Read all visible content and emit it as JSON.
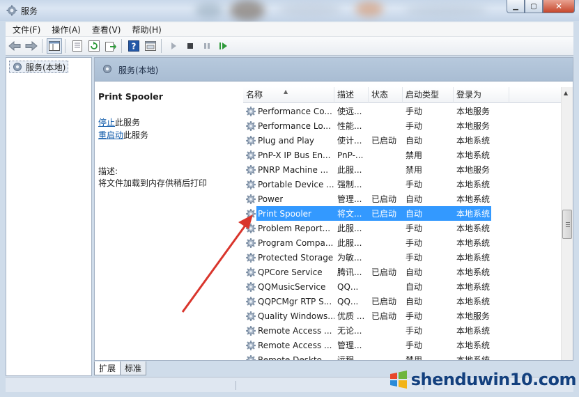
{
  "window": {
    "title": "服务"
  },
  "menu": [
    "文件(F)",
    "操作(A)",
    "查看(V)",
    "帮助(H)"
  ],
  "tree": {
    "root": "服务(本地)"
  },
  "pane_header": "服务(本地)",
  "details": {
    "service_name": "Print Spooler",
    "stop_link": "停止",
    "stop_suffix": "此服务",
    "restart_link": "重启动",
    "restart_suffix": "此服务",
    "desc_label": "描述:",
    "desc_text": "将文件加载到内存供稍后打印"
  },
  "columns": [
    "名称",
    "描述",
    "状态",
    "启动类型",
    "登录为"
  ],
  "services": [
    {
      "name": "Performance Co...",
      "desc": "使远...",
      "status": "",
      "startup": "手动",
      "logon": "本地服务"
    },
    {
      "name": "Performance Lo...",
      "desc": "性能...",
      "status": "",
      "startup": "手动",
      "logon": "本地服务"
    },
    {
      "name": "Plug and Play",
      "desc": "使计...",
      "status": "已启动",
      "startup": "自动",
      "logon": "本地系统"
    },
    {
      "name": "PnP-X IP Bus En...",
      "desc": "PnP-...",
      "status": "",
      "startup": "禁用",
      "logon": "本地系统"
    },
    {
      "name": "PNRP Machine ...",
      "desc": "此服...",
      "status": "",
      "startup": "禁用",
      "logon": "本地服务"
    },
    {
      "name": "Portable Device ...",
      "desc": "强制...",
      "status": "",
      "startup": "手动",
      "logon": "本地系统"
    },
    {
      "name": "Power",
      "desc": "管理...",
      "status": "已启动",
      "startup": "自动",
      "logon": "本地系统"
    },
    {
      "name": "Print Spooler",
      "desc": "将文...",
      "status": "已启动",
      "startup": "自动",
      "logon": "本地系统",
      "selected": true
    },
    {
      "name": "Problem Report...",
      "desc": "此服...",
      "status": "",
      "startup": "手动",
      "logon": "本地系统"
    },
    {
      "name": "Program Compa...",
      "desc": "此服...",
      "status": "",
      "startup": "手动",
      "logon": "本地系统"
    },
    {
      "name": "Protected Storage",
      "desc": "为敏...",
      "status": "",
      "startup": "手动",
      "logon": "本地系统"
    },
    {
      "name": "QPCore Service",
      "desc": "腾讯...",
      "status": "已启动",
      "startup": "自动",
      "logon": "本地系统"
    },
    {
      "name": "QQMusicService",
      "desc": "QQ...",
      "status": "",
      "startup": "自动",
      "logon": "本地系统"
    },
    {
      "name": "QQPCMgr RTP S...",
      "desc": "QQ...",
      "status": "已启动",
      "startup": "自动",
      "logon": "本地系统"
    },
    {
      "name": "Quality Windows...",
      "desc": "优质 ...",
      "status": "已启动",
      "startup": "手动",
      "logon": "本地服务"
    },
    {
      "name": "Remote Access ...",
      "desc": "无论...",
      "status": "",
      "startup": "手动",
      "logon": "本地系统"
    },
    {
      "name": "Remote Access ...",
      "desc": "管理...",
      "status": "",
      "startup": "手动",
      "logon": "本地系统"
    },
    {
      "name": "Remote Deskto...",
      "desc": "远程...",
      "status": "",
      "startup": "禁用",
      "logon": "本地系统"
    }
  ],
  "tabs": [
    "扩展",
    "标准"
  ],
  "watermark": "shenduwin10.com",
  "colors": {
    "selection": "#3399ff",
    "link": "#0b57a8",
    "arrow": "#d9352c"
  }
}
